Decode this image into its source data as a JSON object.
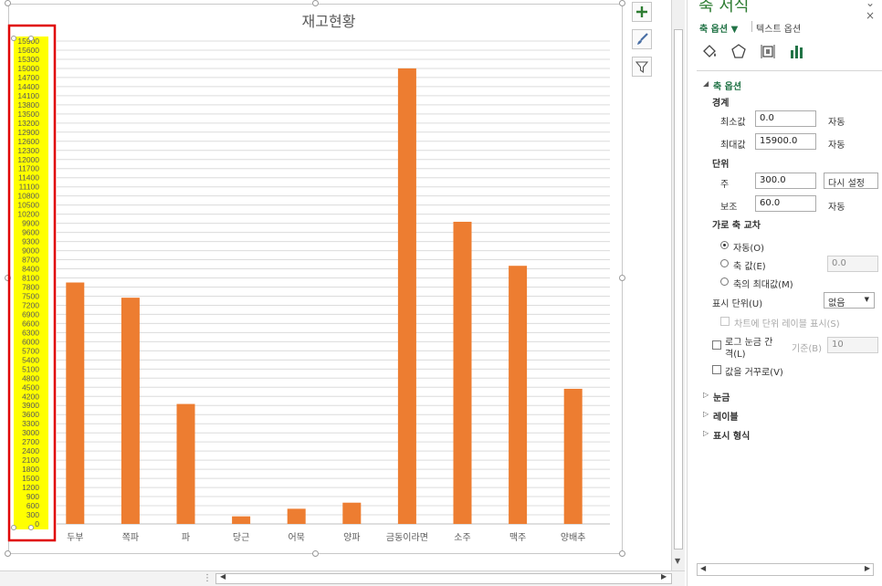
{
  "chart_data": {
    "type": "bar",
    "title": "재고현황",
    "categories": [
      "두부",
      "쪽파",
      "파",
      "당근",
      "어묵",
      "양파",
      "금동이라면",
      "소주",
      "맥주",
      "양배추"
    ],
    "values": [
      7950,
      7450,
      3950,
      250,
      500,
      700,
      15000,
      9950,
      8500,
      4450
    ],
    "ylim": [
      0,
      15900
    ],
    "ytick_step": 300,
    "y_ticks": [
      "0",
      "300",
      "600",
      "900",
      "1200",
      "1500",
      "1800",
      "2100",
      "2400",
      "2700",
      "3000",
      "3300",
      "3600",
      "3900",
      "4200",
      "4500",
      "4800",
      "5100",
      "5400",
      "5700",
      "6000",
      "6300",
      "6600",
      "6900",
      "7200",
      "7500",
      "7800",
      "8100",
      "8400",
      "8700",
      "9000",
      "9300",
      "9600",
      "9900",
      "10200",
      "10500",
      "10800",
      "11100",
      "11400",
      "11700",
      "12000",
      "12300",
      "12600",
      "12900",
      "13200",
      "13500",
      "13800",
      "14100",
      "14400",
      "14700",
      "15000",
      "15300",
      "15600",
      "15900"
    ],
    "xlabel": "",
    "ylabel": "",
    "grid": true,
    "legend": "none",
    "bar_color": "#ed7d31",
    "axis_highlight_color": "#ffff00",
    "selection_outline_color": "#e00000"
  },
  "chart_tools": {
    "add_element_icon": "plus-icon",
    "style_icon": "brush-icon",
    "filter_icon": "filter-icon"
  },
  "pane": {
    "title": "축 서식",
    "tabs": {
      "axis_options": "축 옵션 ▼",
      "text_options": "텍스트 옵션"
    },
    "icons": [
      "fill-line-icon",
      "effects-icon",
      "size-properties-icon",
      "axis-options-icon"
    ],
    "section_axis_options": "축 옵션",
    "bounds": {
      "heading": "경계",
      "min_label": "최소값",
      "min_value": "0.0",
      "min_mode": "자동",
      "max_label": "최대값",
      "max_value": "15900.0",
      "max_mode": "자동"
    },
    "units": {
      "heading": "단위",
      "major_label": "주",
      "major_value": "300.0",
      "major_mode": "다시 설정",
      "minor_label": "보조",
      "minor_value": "60.0",
      "minor_mode": "자동"
    },
    "crosses": {
      "heading": "가로 축 교차",
      "auto": "자동(O)",
      "axis_value": "축 값(E)",
      "axis_value_input": "0.0",
      "max_value": "축의 최대값(M)"
    },
    "display_units": {
      "label": "표시 단위(U)",
      "value": "없음"
    },
    "show_units_label": "차트에 단위 레이블 표시(S)",
    "log_scale": {
      "label_line1": "로그 눈금 간",
      "label_line2": "격(L)",
      "base_label": "기준(B)",
      "base_value": "10"
    },
    "reverse": "값을 거꾸로(V)",
    "sections": [
      "눈금",
      "레이블",
      "표시 형식"
    ]
  }
}
